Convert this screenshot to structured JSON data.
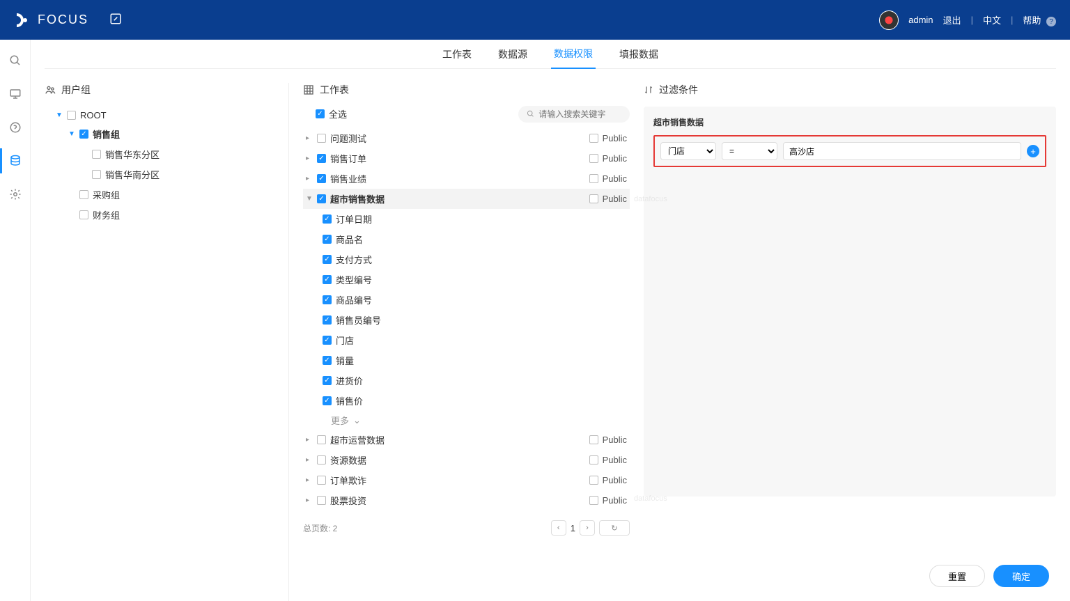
{
  "header": {
    "brand": "FOCUS",
    "user": "admin",
    "logout": "退出",
    "lang": "中文",
    "help": "帮助"
  },
  "tabs": [
    {
      "label": "工作表"
    },
    {
      "label": "数据源"
    },
    {
      "label": "数据权限",
      "active": true
    },
    {
      "label": "填报数据"
    }
  ],
  "userGroup": {
    "title": "用户组",
    "root": "ROOT",
    "sales": "销售组",
    "salesEast": "销售华东分区",
    "salesSouth": "销售华南分区",
    "purchase": "采购组",
    "finance": "财务组"
  },
  "worksheet": {
    "title": "工作表",
    "selectAll": "全选",
    "searchPlaceholder": "请输入搜索关键字",
    "public": "Public",
    "tables": [
      {
        "label": "问题测试",
        "checked": false
      },
      {
        "label": "销售订单",
        "checked": true
      },
      {
        "label": "销售业绩",
        "checked": true
      },
      {
        "label": "超市销售数据",
        "checked": true,
        "active": true
      },
      {
        "label": "超市运营数据",
        "checked": false
      },
      {
        "label": "资源数据",
        "checked": false
      },
      {
        "label": "订单欺诈",
        "checked": false
      },
      {
        "label": "股票投资",
        "checked": false
      }
    ],
    "columns": [
      "订单日期",
      "商品名",
      "支付方式",
      "类型编号",
      "商品编号",
      "销售员编号",
      "门店",
      "销量",
      "进货价",
      "销售价"
    ],
    "more": "更多",
    "totalPagesLabel": "总页数: 2",
    "page": "1"
  },
  "filter": {
    "title": "过滤条件",
    "source": "超市销售数据",
    "field": "门店",
    "op": "=",
    "value": "高沙店"
  },
  "buttons": {
    "reset": "重置",
    "confirm": "确定"
  }
}
